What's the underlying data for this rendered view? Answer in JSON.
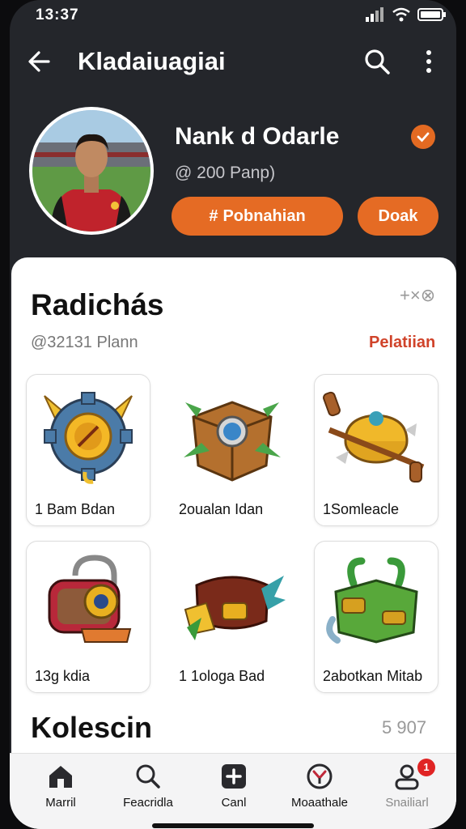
{
  "status_bar": {
    "time": "13:37"
  },
  "app_bar": {
    "title": "Kladaiuagiai"
  },
  "profile": {
    "name": "Nank d Odarle",
    "handle": "@ 200 Panp)",
    "primary_button": "Pobnahian",
    "secondary_button": "Doak",
    "accent_color": "#e56b24"
  },
  "section": {
    "title": "Radichás",
    "subtitle": "@32131 Plann",
    "link": "Pelatiian",
    "icon_text": "+×⊗",
    "items": [
      {
        "label": "1 Bam Bdan",
        "icon": "gear-shield-icon"
      },
      {
        "label": "2oualan Idan",
        "icon": "chest-icon"
      },
      {
        "label": "1Somleacle",
        "icon": "pot-icon"
      },
      {
        "label": "13g kdia",
        "icon": "lock-icon"
      },
      {
        "label": "1 1ologa Bad",
        "icon": "scroll-icon"
      },
      {
        "label": "2abotkan Mitab",
        "icon": "green-box-icon"
      }
    ]
  },
  "section2": {
    "title": "Kolescin",
    "count": "5 907"
  },
  "nav": [
    {
      "label": "Marril",
      "icon": "home-icon"
    },
    {
      "label": "Feacridla",
      "icon": "search-icon"
    },
    {
      "label": "Canl",
      "icon": "plus-square-icon"
    },
    {
      "label": "Moaathale",
      "icon": "compass-icon"
    },
    {
      "label": "Snailiarl",
      "icon": "profile-icon",
      "badge": "1"
    }
  ]
}
